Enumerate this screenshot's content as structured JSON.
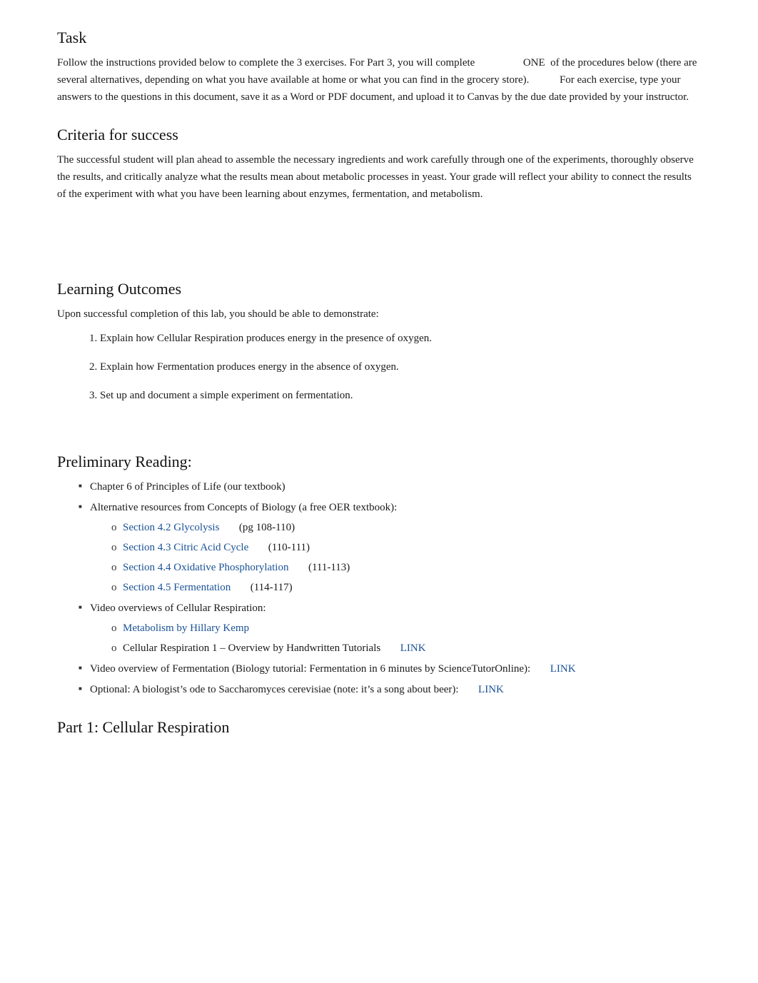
{
  "page": {
    "task": {
      "heading": "Task",
      "body": "Follow the instructions provided below to complete the 3 exercises. For Part 3, you will complete ONE of the procedures below (there are several alternatives, depending on what you have available at home or what you can find in the grocery store). For each exercise, type your answers to the questions in this document, save it as a Word or PDF document, and upload it to Canvas by the due date provided by your instructor."
    },
    "criteria": {
      "heading": "Criteria for success",
      "body": "The successful student will plan ahead to assemble the necessary ingredients and work carefully through one of the experiments, thoroughly observe the results, and critically analyze what the results mean about metabolic processes in yeast. Your grade will reflect your ability to connect the results of the experiment with what you have been learning about enzymes, fermentation, and metabolism."
    },
    "learning_outcomes": {
      "heading": "Learning Outcomes",
      "intro": "Upon successful completion of this lab, you should be able to demonstrate:",
      "items": [
        "Explain how Cellular Respiration produces energy in the presence of oxygen.",
        "Explain how Fermentation produces energy in the absence of oxygen.",
        "Set up and document a simple experiment on fermentation."
      ]
    },
    "preliminary_reading": {
      "heading": "Preliminary Reading:",
      "bullet1": "Chapter 6 of Principles of Life (our textbook)",
      "bullet2": "Alternative resources from Concepts of Biology (a free OER textbook):",
      "sub_items": [
        {
          "label": "Section 4.2 Glycolysis",
          "pages": "(pg 108-110)"
        },
        {
          "label": "Section 4.3 Citric Acid Cycle",
          "pages": "(110-111)"
        },
        {
          "label": "Section 4.4 Oxidative Phosphorylation",
          "pages": "(111-113)"
        },
        {
          "label": "Section 4.5 Fermentation",
          "pages": "(114-117)"
        }
      ],
      "bullet3": "Video overviews of Cellular Respiration:",
      "video_items": [
        {
          "label": "Metabolism by Hillary Kemp",
          "link": null
        },
        {
          "label": "Cellular Respiration 1 – Overview by Handwritten Tutorials",
          "link": "LINK"
        }
      ],
      "bullet4": "Video overview of Fermentation (Biology tutorial: Fermentation in 6 minutes by ScienceTutorOnline):",
      "bullet4_link": "LINK",
      "bullet5": "Optional: A biologist’s ode to Saccharomyces cerevisiae (note: it’s a song about beer):",
      "bullet5_link": "LINK"
    },
    "part1": {
      "heading": "Part 1: Cellular Respiration"
    }
  }
}
